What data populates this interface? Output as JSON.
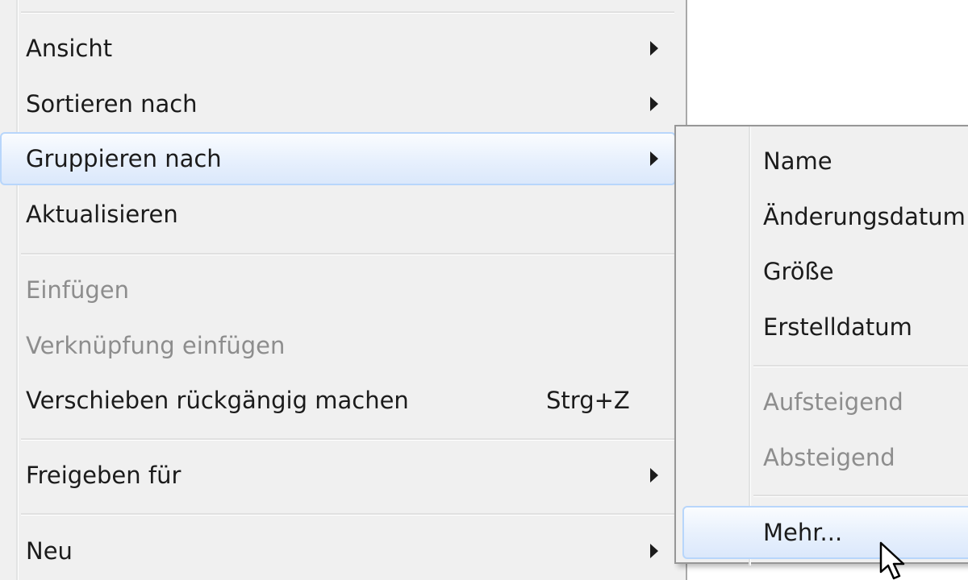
{
  "main_menu": {
    "items": [
      {
        "label": "Ansicht"
      },
      {
        "label": "Sortieren nach"
      },
      {
        "label": "Gruppieren nach"
      },
      {
        "label": "Aktualisieren"
      },
      {
        "label": "Einfügen"
      },
      {
        "label": "Verknüpfung einfügen"
      },
      {
        "label": "Verschieben rückgängig machen",
        "shortcut": "Strg+Z"
      },
      {
        "label": "Freigeben für"
      },
      {
        "label": "Neu"
      }
    ]
  },
  "submenu": {
    "items": [
      {
        "label": "Name"
      },
      {
        "label": "Änderungsdatum"
      },
      {
        "label": "Größe"
      },
      {
        "label": "Erstelldatum"
      },
      {
        "label": "Aufsteigend"
      },
      {
        "label": "Absteigend"
      },
      {
        "label": "Mehr..."
      }
    ]
  },
  "icons": {
    "submenu_arrow": "chevron-right-icon",
    "cursor": "mouse-pointer-icon"
  },
  "colors": {
    "menu_background": "#f0f0f0",
    "highlight_border": "#b8d6fb",
    "disabled_text": "#8d8d8d",
    "text": "#1b1b1b"
  }
}
